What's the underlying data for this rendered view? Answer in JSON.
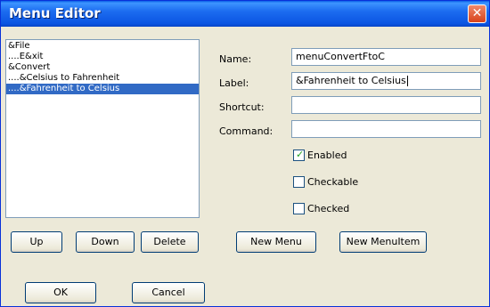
{
  "window": {
    "title": "Menu Editor",
    "close_glyph": "✕"
  },
  "menu_list": {
    "items": [
      {
        "label": "&File",
        "selected": false
      },
      {
        "label": "....E&xit",
        "selected": false
      },
      {
        "label": "&Convert",
        "selected": false
      },
      {
        "label": "....&Celsius to Fahrenheit",
        "selected": false
      },
      {
        "label": "....&Fahrenheit to Celsius",
        "selected": true
      }
    ]
  },
  "list_buttons": {
    "up": "Up",
    "down": "Down",
    "delete": "Delete"
  },
  "form": {
    "name_label": "Name:",
    "name_value": "menuConvertFtoC",
    "label_label": "Label:",
    "label_value": "&Fahrenheit to Celsius",
    "shortcut_label": "Shortcut:",
    "shortcut_value": "",
    "command_label": "Command:",
    "command_value": "",
    "enabled_label": "Enabled",
    "enabled_checked": true,
    "checkable_label": "Checkable",
    "checkable_checked": false,
    "checked_label": "Checked",
    "checked_checked": false
  },
  "form_buttons": {
    "new_menu": "New Menu",
    "new_menuitem": "New MenuItem"
  },
  "dialog_buttons": {
    "ok": "OK",
    "cancel": "Cancel"
  }
}
